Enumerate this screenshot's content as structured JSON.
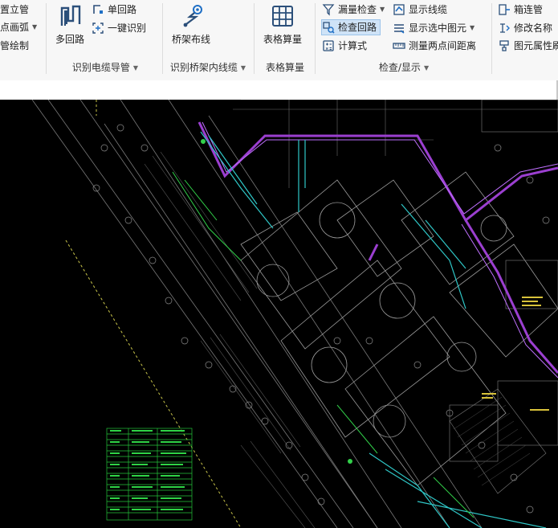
{
  "ribbon": {
    "col0": {
      "item1": "置立管",
      "item2": "点画弧",
      "item3": "管绘制"
    },
    "group_cable": {
      "multi_loop": "多回路",
      "single_loop": "单回路",
      "auto_identify": "一键识别",
      "label": "识别电缆导管"
    },
    "group_tray": {
      "tray_wiring": "桥架布线",
      "label": "识别桥架内线缆"
    },
    "group_table": {
      "table_calc": "表格算量",
      "label": "表格算量"
    },
    "group_check": {
      "missing_check": "漏量检查",
      "check_loop": "检查回路",
      "formula": "计算式",
      "show_cables": "显示线缆",
      "show_selected": "显示选中图元",
      "measure_distance": "测量两点间距离",
      "label": "检查/显示"
    },
    "col_right": {
      "box_pipe": "箱连管",
      "rename": "修改名称",
      "elem_props": "图元属性刷"
    }
  },
  "colors": {
    "ribbon_bg": "#f7f7f7",
    "canvas_bg": "#000000",
    "accent": "#1f6fc5",
    "tray": "#9b3fd0"
  }
}
